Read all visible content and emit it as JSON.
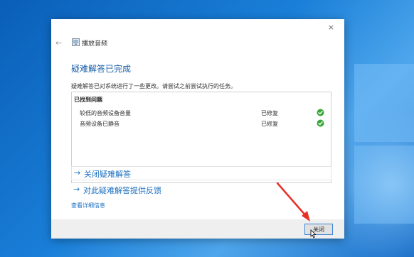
{
  "window": {
    "title": "播放音频",
    "close_glyph": "×",
    "back_glyph": "←"
  },
  "heading": "疑难解答已完成",
  "description": "疑难解答已对系统进行了一些更改。请尝试之前尝试执行的任务。",
  "issues": {
    "header": "已找到问题",
    "items": [
      {
        "name": "较低的音频设备音量",
        "status": "已修复"
      },
      {
        "name": "音频设备已静音",
        "status": "已修复"
      }
    ]
  },
  "links": {
    "close_troubleshooter": "关闭疑难解答",
    "feedback": "对此疑难解答提供反馈",
    "arrow_glyph": "→"
  },
  "details_link": "查看详细信息",
  "footer": {
    "close_button": "关闭"
  },
  "colors": {
    "accent": "#1b6fc0",
    "check_green": "#3aa53a",
    "annotation_red": "#e8302a"
  }
}
